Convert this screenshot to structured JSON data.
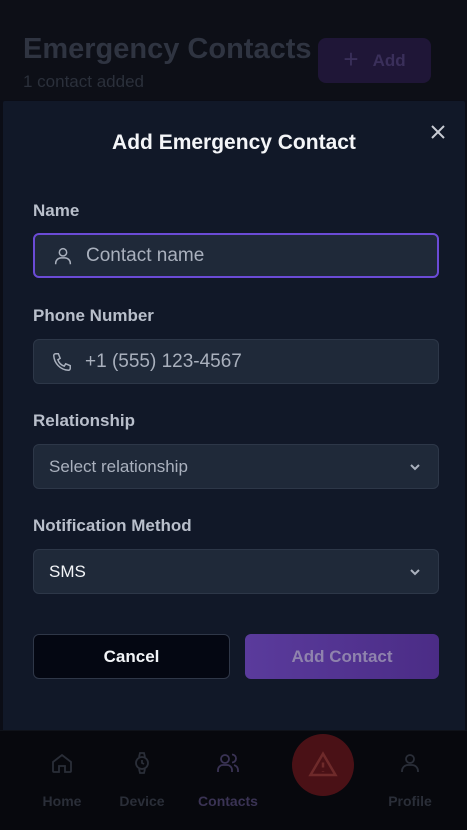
{
  "background": {
    "title": "Emergency Contacts",
    "subtitle": "1 contact added",
    "add_button": {
      "icon": "plus-icon",
      "label": "Add"
    },
    "nav": [
      {
        "icon": "home-icon",
        "label": "Home"
      },
      {
        "icon": "watch-icon",
        "label": "Device"
      },
      {
        "icon": "users-icon",
        "label": "Contacts",
        "active": true
      },
      {
        "icon": "alert-triangle-icon",
        "label": ""
      },
      {
        "icon": "user-icon",
        "label": "Profile"
      }
    ]
  },
  "modal": {
    "title": "Add Emergency Contact",
    "close_icon": "close-icon",
    "name": {
      "label": "Name",
      "placeholder": "Contact name",
      "value": "",
      "icon": "user-icon"
    },
    "phone": {
      "label": "Phone Number",
      "placeholder": "+1 (555) 123-4567",
      "value": "",
      "icon": "phone-icon"
    },
    "relationship": {
      "label": "Relationship",
      "value": "Select relationship",
      "icon": "chevron-down-icon"
    },
    "notification": {
      "label": "Notification Method",
      "value": "SMS",
      "icon": "chevron-down-icon"
    },
    "cancel_label": "Cancel",
    "submit_label": "Add Contact"
  },
  "colors": {
    "accent": "#6b4bd6",
    "modal_bg": "#111828",
    "field_bg": "#1f2939",
    "sos": "#4a1116"
  }
}
